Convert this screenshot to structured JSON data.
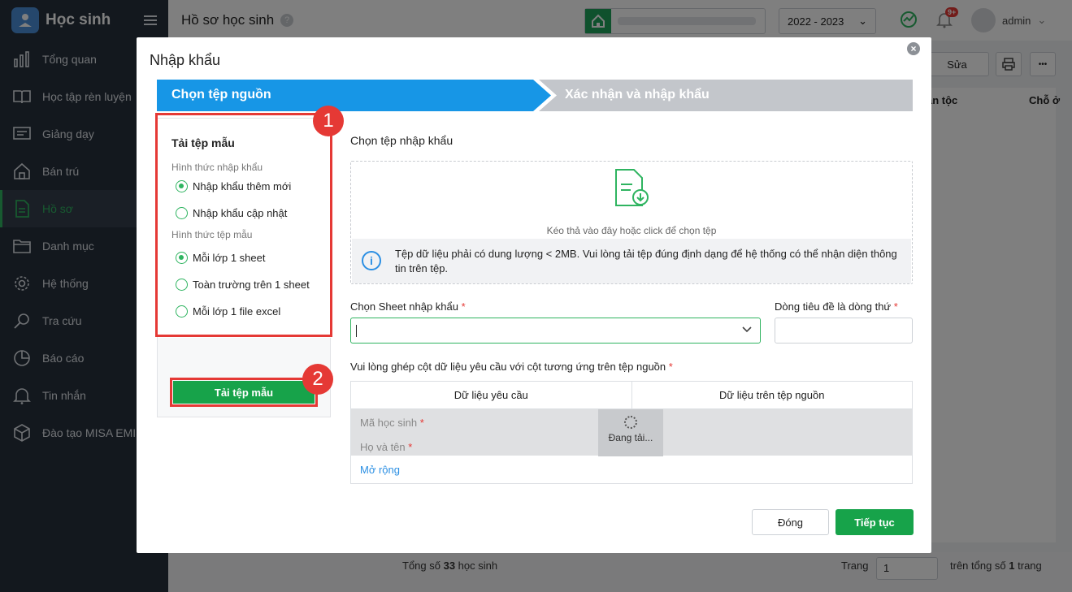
{
  "app": {
    "name": "Học sinh"
  },
  "sidebar": {
    "items": [
      {
        "label": "Tổng quan",
        "icon": "chart-bars-icon"
      },
      {
        "label": "Học tập rèn luyện",
        "icon": "book-icon"
      },
      {
        "label": "Giảng dạy",
        "icon": "board-icon"
      },
      {
        "label": "Bán trú",
        "icon": "home-icon"
      },
      {
        "label": "Hồ sơ",
        "icon": "profile-document-icon",
        "active": true
      },
      {
        "label": "Danh mục",
        "icon": "folder-icon"
      },
      {
        "label": "Hệ thống",
        "icon": "gear-icon"
      },
      {
        "label": "Tra cứu",
        "icon": "search-icon"
      },
      {
        "label": "Báo cáo",
        "icon": "pie-chart-icon"
      },
      {
        "label": "Tin nhắn",
        "icon": "bell-icon"
      },
      {
        "label": "Đào tạo MISA EMIS",
        "icon": "cube-icon"
      }
    ]
  },
  "header": {
    "title": "Hồ sơ học sinh",
    "help": "?",
    "year": "2022 - 2023",
    "notification_badge": "9+",
    "user": "admin"
  },
  "background": {
    "edit_label": "Sửa",
    "more_label": "•••",
    "col_ethnicity": "ân tộc",
    "col_residence": "Chỗ ở",
    "footer_total_prefix": "Tổng số ",
    "footer_total_count": "33",
    "footer_total_suffix": " học sinh",
    "page_label": "Trang",
    "page_value": "1",
    "total_pages_prefix": "trên tổng số ",
    "total_pages_count": "1",
    "total_pages_suffix": " trang"
  },
  "modal": {
    "title": "Nhập khẩu",
    "close": "×",
    "steps": [
      "Chọn tệp nguồn",
      "Xác nhận và nhập khẩu"
    ],
    "left": {
      "title": "Tải tệp mẫu",
      "import_type_label": "Hình thức nhập khẩu",
      "import_types": [
        "Nhập khẩu thêm mới",
        "Nhập khẩu cập nhật"
      ],
      "template_type_label": "Hình thức tệp mẫu",
      "template_types": [
        "Mỗi lớp 1 sheet",
        "Toàn trường trên 1 sheet",
        "Mỗi lớp 1 file excel"
      ],
      "download_button": "Tải tệp mẫu"
    },
    "right": {
      "title": "Chọn tệp nhập khẩu",
      "drop_text": "Kéo thả vào đây hoặc click để chọn tệp",
      "info_text": "Tệp dữ liệu phải có dung lượng < 2MB. Vui lòng tải tệp đúng định dạng để hệ thống có thể nhận diện thông tin trên tệp.",
      "sheet_label": "Chọn Sheet nhập khẩu",
      "sheet_value": "",
      "header_row_label": "Dòng tiêu đề là dòng thứ",
      "header_row_value": "",
      "mapping_label": "Vui lòng ghép cột dữ liệu yêu cầu với cột tương ứng trên tệp nguồn",
      "mapping_headers": [
        "Dữ liệu yêu cầu",
        "Dữ liệu trên tệp nguồn"
      ],
      "mapping_rows": [
        "Mã học sinh",
        "Họ và tên"
      ],
      "loading_text": "Đang tải...",
      "expand_link": "Mở rộng"
    },
    "buttons": {
      "close": "Đóng",
      "next": "Tiếp tục"
    }
  },
  "annotations": [
    "1",
    "2"
  ],
  "colors": {
    "primary_green": "#17a34a",
    "step_blue": "#1796e6",
    "annotation_red": "#e53935",
    "sidebar_bg": "#27313d"
  }
}
